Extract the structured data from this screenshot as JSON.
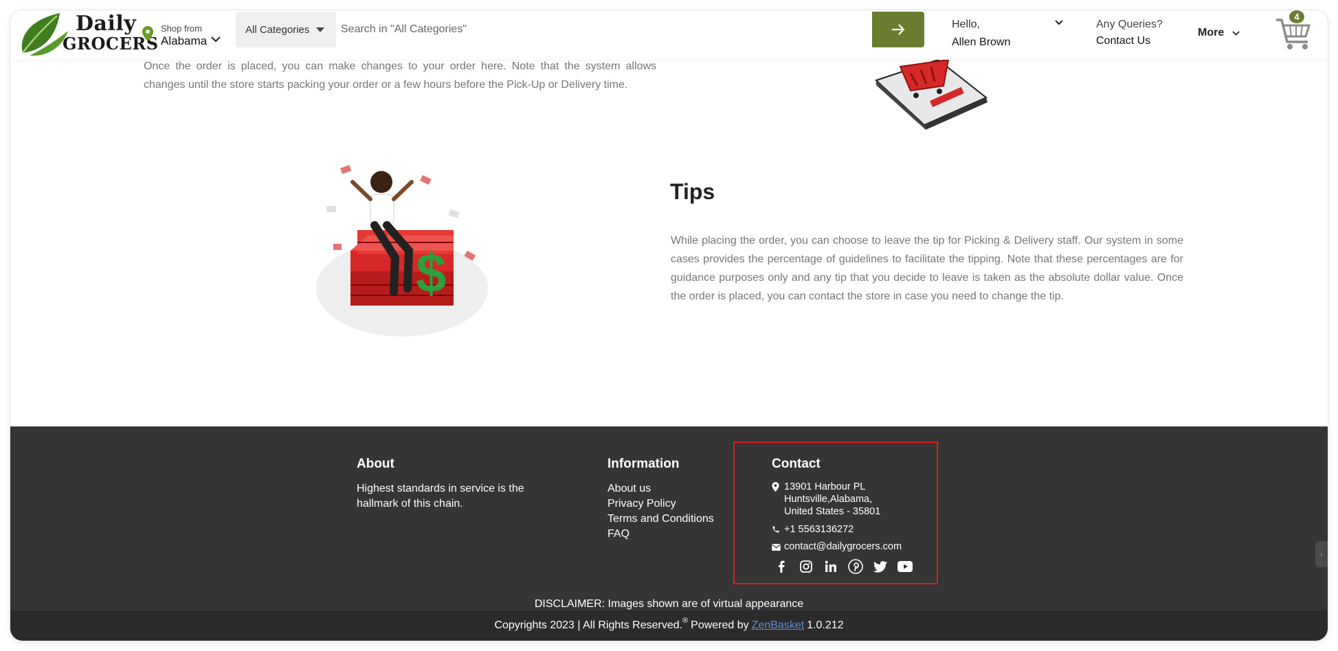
{
  "header": {
    "logo": {
      "line1": "Daily",
      "line2": "GROCERS"
    },
    "shop_from": {
      "label": "Shop from",
      "value": "Alabama"
    },
    "search": {
      "category": "All Categories",
      "placeholder": "Search in \"All Categories\""
    },
    "user": {
      "greeting": "Hello,",
      "name": "Allen Brown"
    },
    "queries": {
      "label": "Any Queries?",
      "link": "Contact Us"
    },
    "more_label": "More",
    "cart_count": "4"
  },
  "content": {
    "order_paragraph": "Once the order is placed, you can make changes to your order here. Note that the system allows changes until the store starts packing your order or a few hours before the Pick-Up or Delivery time.",
    "tips_title": "Tips",
    "tips_paragraph": "While placing the order, you can choose to leave the tip for Picking & Delivery staff. Our system in some cases provides the percentage of guidelines to facilitate the tipping. Note that these percentages are for guidance purposes only and any tip that you decide to leave is taken as the absolute dollar value. Once the order is placed, you can contact the store in case you need to change the tip."
  },
  "footer": {
    "about": {
      "heading": "About",
      "text": "Highest standards in service is the hallmark of this chain."
    },
    "information": {
      "heading": "Information",
      "links": [
        "About us",
        "Privacy Policy",
        "Terms and Conditions",
        "FAQ"
      ]
    },
    "contact": {
      "heading": "Contact",
      "address_line1": "13901 Harbour PL",
      "address_line2": "Huntsville,Alabama,",
      "address_line3": "United States - 35801",
      "phone": "+1 5563136272",
      "email": "contact@dailygrocers.com",
      "social": [
        "facebook-icon",
        "instagram-icon",
        "linkedin-icon",
        "pinterest-icon",
        "twitter-icon",
        "youtube-icon"
      ]
    },
    "disclaimer": "DISCLAIMER: Images shown are of virtual appearance",
    "copyright": "Copyrights 2023 | All Rights Reserved.",
    "registered_mark": "®",
    "powered_by": "Powered by",
    "powered_link": "ZenBasket",
    "version": "1.0.212"
  },
  "colors": {
    "brand_green": "#6a7d31",
    "footer_bg": "#353535",
    "highlight_red": "#d8201a",
    "link_blue": "#5b8dd8"
  }
}
